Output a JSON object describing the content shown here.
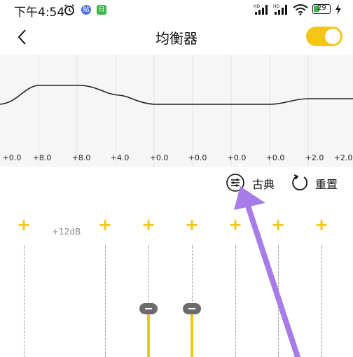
{
  "status": {
    "time": "下午4:54",
    "app_badge_1": "贴",
    "app_badge_2": "日",
    "battery": "29"
  },
  "header": {
    "title": "均衡器"
  },
  "bands": {
    "db_labels": [
      "+0.0",
      "+8.0",
      "+8.0",
      "+4.0",
      "+0.0",
      "+0.0",
      "+0.0",
      "+0.0",
      "+2.0",
      "+2.0"
    ]
  },
  "actions": {
    "preset": "古典",
    "reset": "重置"
  },
  "sliders": {
    "max_label": "+12dB",
    "plus": "+"
  },
  "colors": {
    "accent": "#f5c518",
    "knob": "#6b6b6b",
    "arrow": "#a77be8"
  }
}
